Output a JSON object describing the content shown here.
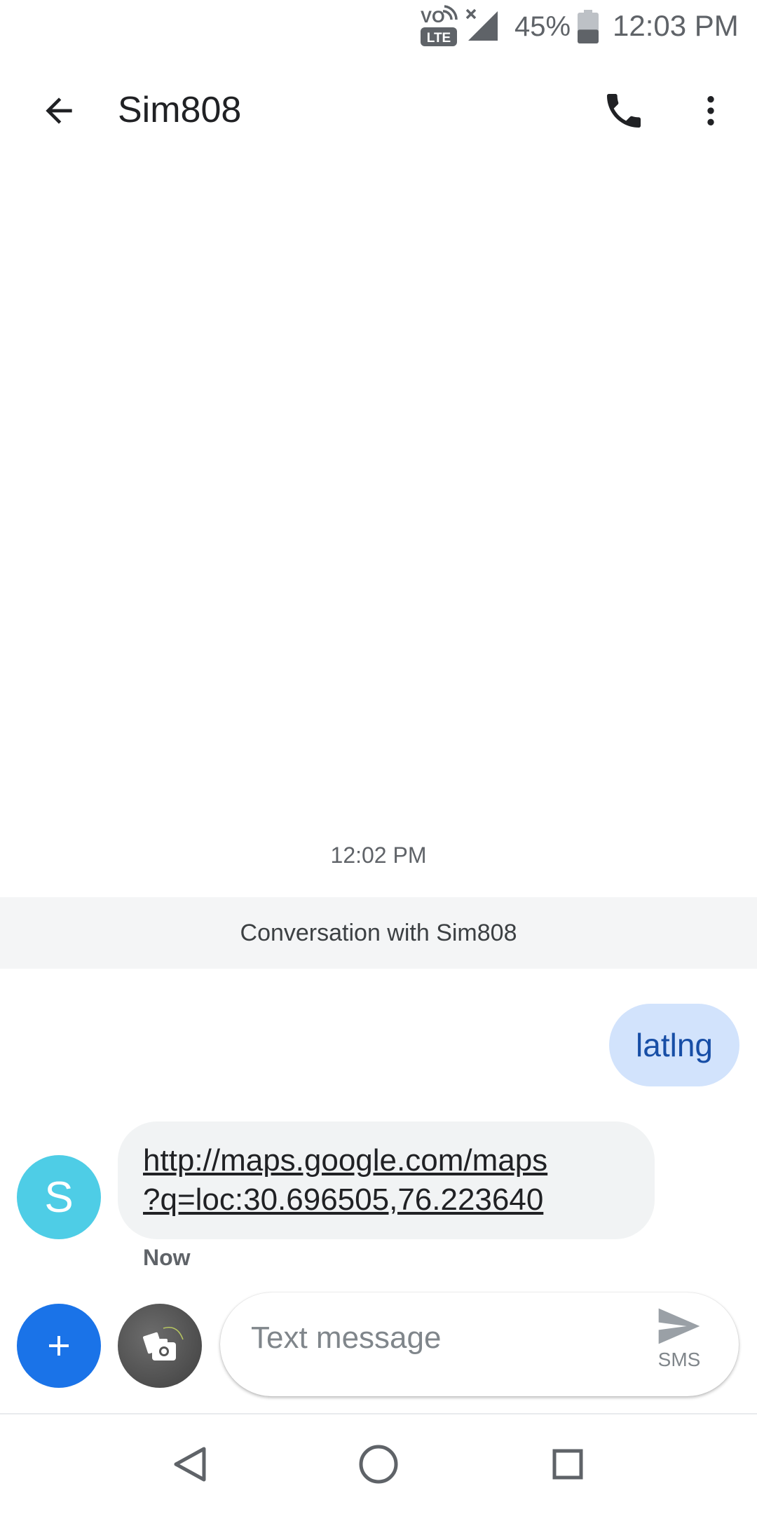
{
  "status_bar": {
    "volte_label": "VO",
    "lte_label": "LTE",
    "battery_percent": "45%",
    "battery_level": 0.45,
    "time": "12:03 PM"
  },
  "app_bar": {
    "title": "Sim808",
    "back_icon": "arrow-back-icon",
    "call_icon": "phone-icon",
    "more_icon": "more-vert-icon"
  },
  "conversation": {
    "timestamp": "12:02 PM",
    "banner": "Conversation with Sim808",
    "sent_message": "latlng",
    "received": {
      "avatar_letter": "S",
      "link_line1": "http://maps.google.com/maps",
      "link_line2": "?q=loc:30.696505,76.223640",
      "time": "Now"
    }
  },
  "compose": {
    "placeholder": "Text message",
    "send_label": "SMS",
    "add_icon": "plus-icon",
    "gallery_icon": "camera-gallery-icon",
    "send_icon": "send-icon"
  },
  "nav_bar": {
    "back_icon": "nav-back-icon",
    "home_icon": "nav-home-icon",
    "recents_icon": "nav-recents-icon"
  },
  "colors": {
    "accent": "#1a73e8",
    "sent_bubble": "#d2e3fc",
    "sent_text": "#174ea6",
    "received_bubble": "#f1f3f4",
    "avatar": "#4ecde6"
  }
}
